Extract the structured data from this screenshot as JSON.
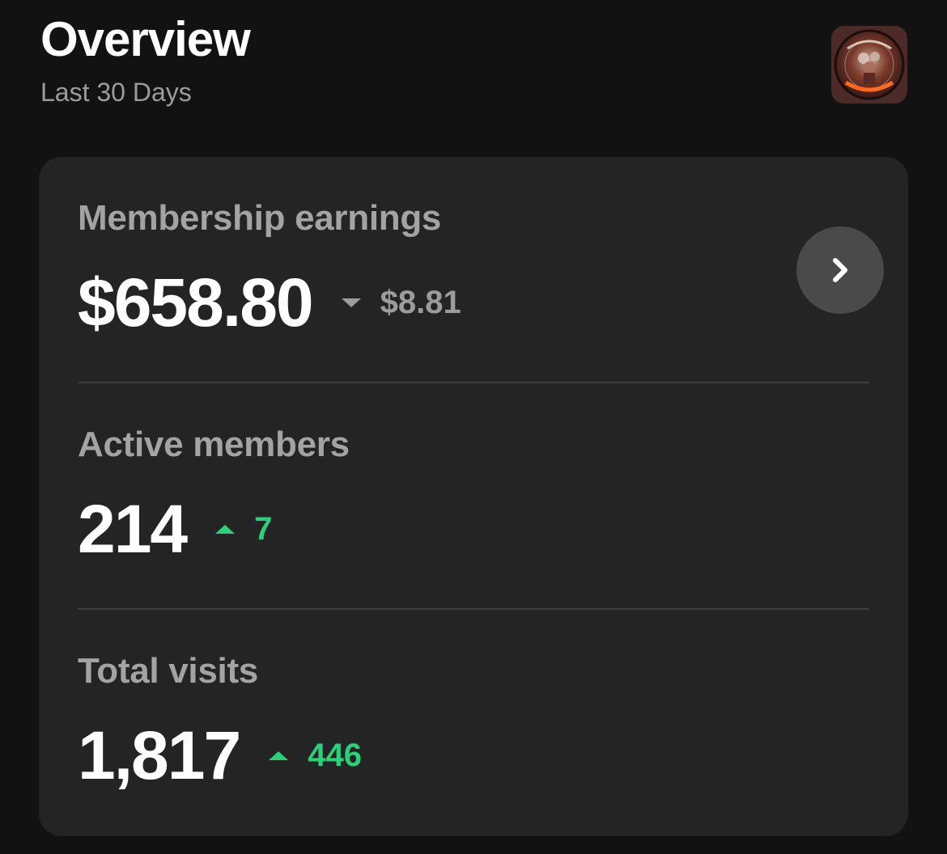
{
  "header": {
    "title": "Overview",
    "subtitle": "Last 30 Days",
    "avatar_icon": "creator-avatar-logo"
  },
  "metrics": [
    {
      "label": "Membership earnings",
      "value": "$658.80",
      "delta": "$8.81",
      "direction": "down",
      "delta_color": "#9c9c9c",
      "has_detail_button": true,
      "detail_icon": "chevron-right-icon"
    },
    {
      "label": "Active members",
      "value": "214",
      "delta": "7",
      "direction": "up",
      "delta_color": "#2bd07a"
    },
    {
      "label": "Total visits",
      "value": "1,817",
      "delta": "446",
      "direction": "up",
      "delta_color": "#2bd07a"
    }
  ],
  "colors": {
    "background": "#121212",
    "card": "#242424",
    "positive": "#2bd07a",
    "neutral": "#9c9c9c"
  }
}
